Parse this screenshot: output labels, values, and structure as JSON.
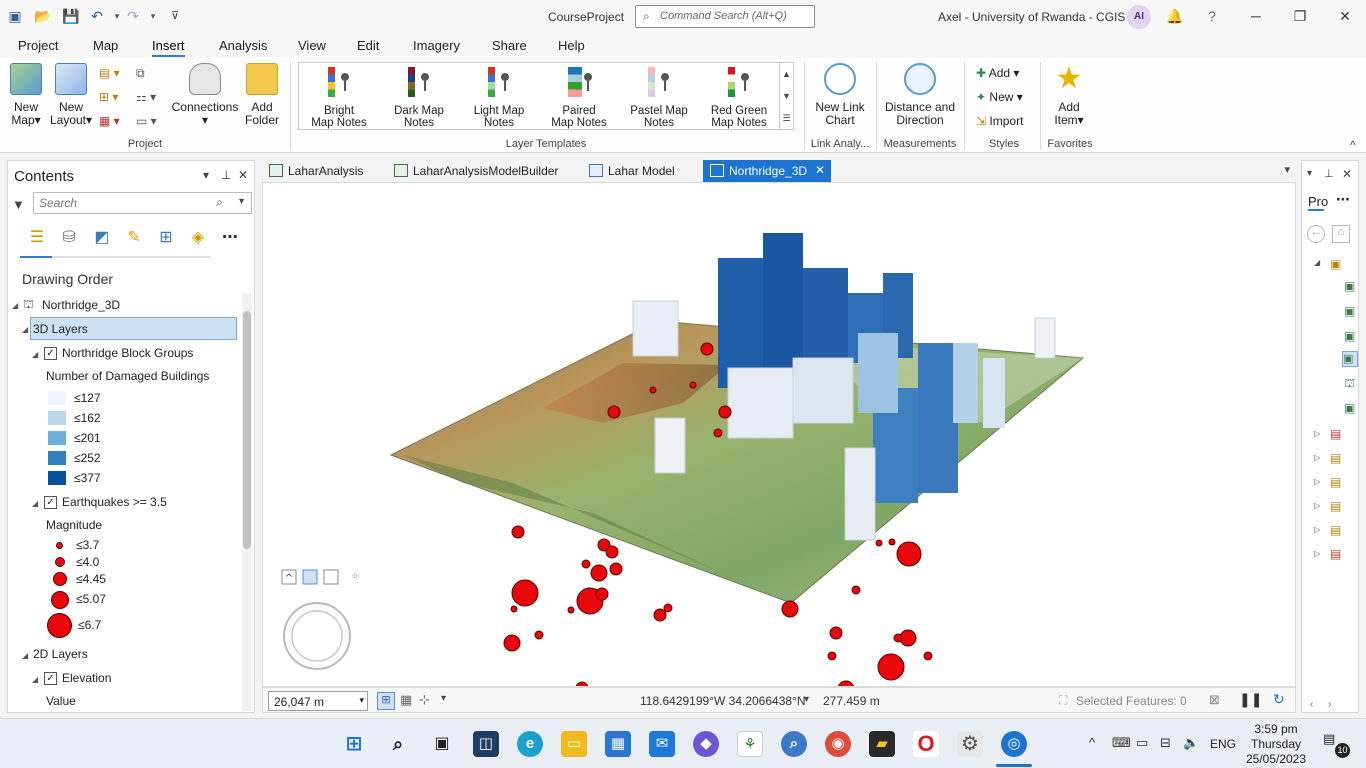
{
  "titlebar": {
    "project_name": "CourseProject",
    "search_placeholder": "Command Search (Alt+Q)",
    "user": "Axel - University of Rwanda - CGIS",
    "avatar_initials": "AI",
    "help": "?"
  },
  "menu": [
    "Project",
    "Map",
    "Insert",
    "Analysis",
    "View",
    "Edit",
    "Imagery",
    "Share",
    "Help"
  ],
  "menu_active": "Insert",
  "ribbon": {
    "project_group": {
      "label": "Project",
      "new_map": "New Map",
      "new_layout": "New Layout",
      "connections": "Connections",
      "add_folder": "Add Folder"
    },
    "layer_templates": {
      "label": "Layer Templates",
      "items": [
        {
          "line1": "Bright",
          "line2": "Map Notes",
          "colors": [
            "#d6302c",
            "#3b6fd1",
            "#f2c52d",
            "#39a845"
          ]
        },
        {
          "line1": "Dark Map",
          "line2": "Notes",
          "colors": [
            "#7a1f2a",
            "#263b8a",
            "#7e6a1d",
            "#235c2b"
          ]
        },
        {
          "line1": "Light Map",
          "line2": "Notes",
          "colors": [
            "#f08c8c",
            "#8fb0ef",
            "#f6e19a",
            "#9bdca4"
          ]
        },
        {
          "line1": "Paired",
          "line2": "Map Notes",
          "colors": [
            "#1f78b4",
            "#a6cee3",
            "#33a02c",
            "#fb9a99"
          ]
        },
        {
          "line1": "Pastel Map",
          "line2": "Notes",
          "colors": [
            "#fbb4ae",
            "#b3cde3",
            "#ccebc5",
            "#decbe4"
          ]
        },
        {
          "line1": "Red Green",
          "line2": "Map Notes",
          "colors": [
            "#d7191c",
            "#fdae61",
            "#a6d96a",
            "#1a9641"
          ]
        }
      ]
    },
    "link_analysis": {
      "label": "Link Analy...",
      "new_link_chart": "New Link Chart"
    },
    "measurements": {
      "label": "Measurements",
      "distance": "Distance and Direction"
    },
    "styles": {
      "label": "Styles",
      "add": "Add",
      "new": "New",
      "import": "Import"
    },
    "favorites": {
      "label": "Favorites",
      "add_item": "Add Item"
    }
  },
  "contents": {
    "title": "Contents",
    "search_placeholder": "Search",
    "drawing_order": "Drawing Order",
    "map_name": "Northridge_3D",
    "group_3d": "3D Layers",
    "layer1": {
      "name": "Northridge Block Groups",
      "field": "Number of Damaged Buildings",
      "classes": [
        {
          "label": "≤127",
          "color": "#eff3ff"
        },
        {
          "label": "≤162",
          "color": "#bdd7e7"
        },
        {
          "label": "≤201",
          "color": "#6baed6"
        },
        {
          "label": "≤252",
          "color": "#3182bd"
        },
        {
          "label": "≤377",
          "color": "#08519c"
        }
      ]
    },
    "layer2": {
      "name": "Earthquakes >= 3.5",
      "field": "Magnitude",
      "classes": [
        {
          "label": "≤3.7"
        },
        {
          "label": "≤4.0"
        },
        {
          "label": "≤4.45"
        },
        {
          "label": "≤5.07"
        },
        {
          "label": "≤6.7"
        }
      ]
    },
    "group_2d": "2D Layers",
    "layer3": {
      "name": "Elevation",
      "field": "Value"
    }
  },
  "doc_tabs": [
    {
      "label": "LaharAnalysis"
    },
    {
      "label": "LaharAnalysisModelBuilder"
    },
    {
      "label": "Lahar Model"
    },
    {
      "label": "Northridge_3D"
    }
  ],
  "map_status": {
    "scale": "26,047 m",
    "coordinates": "118.6429199°W 34.2066438°N",
    "elevation": "277.459 m",
    "selected_features": "Selected Features: 0"
  },
  "right_panel": {
    "title": "Pro"
  },
  "taskbar": {
    "lang": "ENG",
    "time": "3:59 pm",
    "day": "Thursday",
    "date": "25/05/2023",
    "notifications": "10"
  }
}
